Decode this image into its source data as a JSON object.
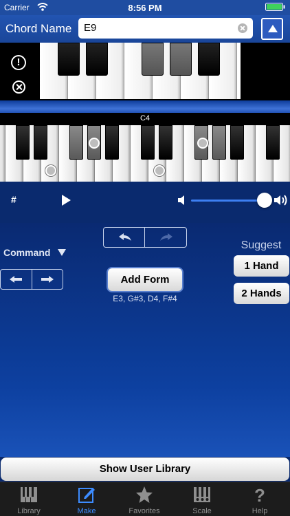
{
  "status": {
    "carrier": "Carrier",
    "time": "8:56 PM"
  },
  "nav": {
    "title": "Chord Name",
    "chord_value": "E9"
  },
  "keyboard": {
    "octave_label": "C4"
  },
  "controls": {
    "sharp_label": "#"
  },
  "command": {
    "label": "Command"
  },
  "add_form": {
    "label": "Add Form",
    "notes": "E3, G#3, D4, F#4"
  },
  "suggest": {
    "label": "Suggest",
    "one_hand": "1 Hand",
    "two_hands": "2 Hands"
  },
  "library": {
    "show_label": "Show User Library"
  },
  "tabs": [
    {
      "label": "Library",
      "icon": "library-icon"
    },
    {
      "label": "Make",
      "icon": "edit-icon"
    },
    {
      "label": "Favorites",
      "icon": "star-icon"
    },
    {
      "label": "Scale",
      "icon": "scale-icon"
    },
    {
      "label": "Help",
      "icon": "help-icon"
    }
  ],
  "colors": {
    "accent": "#3d8cff",
    "background": "#0a2a6e",
    "nav": "#2254b1"
  }
}
